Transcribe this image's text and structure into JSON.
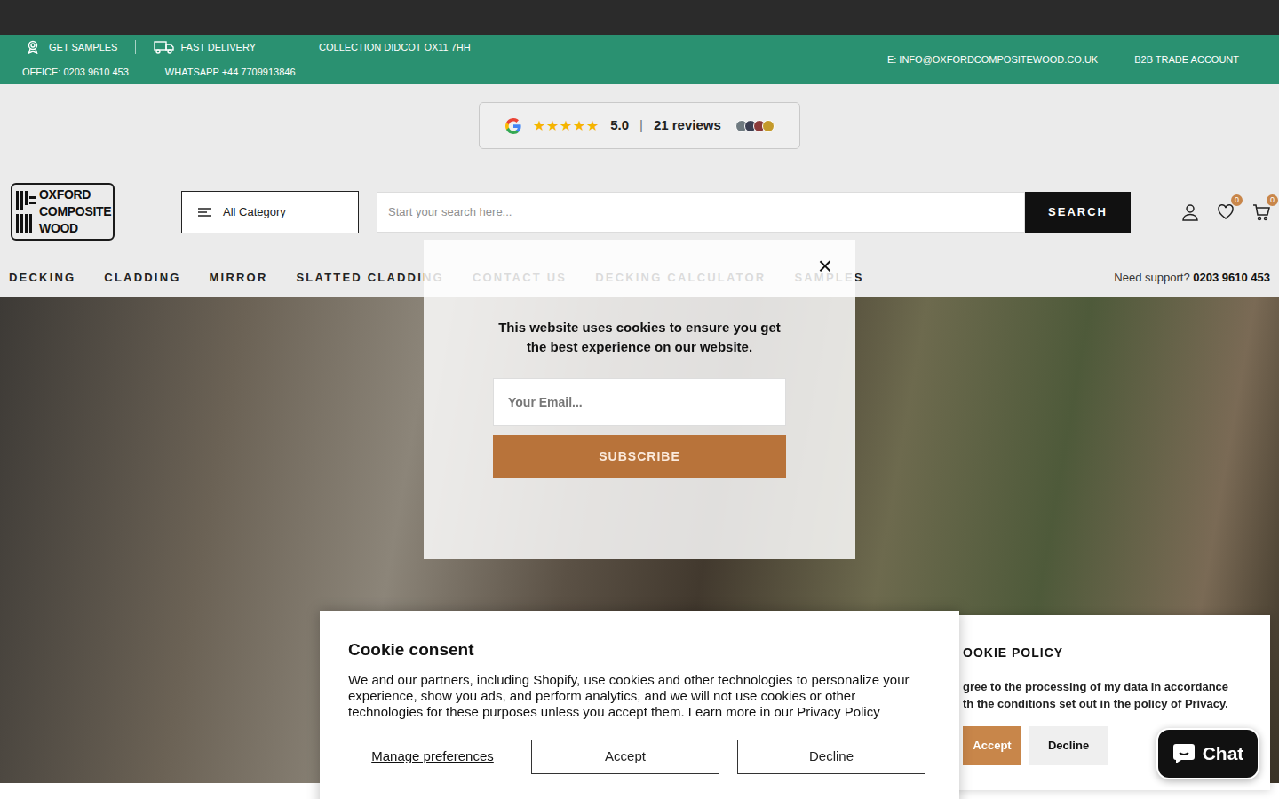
{
  "info_bar": {
    "row1": [
      "GET SAMPLES",
      "FAST DELIVERY",
      "COLLECTION DIDCOT OX11 7HH"
    ],
    "row2": [
      "OFFICE: 0203 9610 453",
      "WHATSAPP +44 7709913846"
    ],
    "right": [
      "E: INFO@OXFORDCOMPOSITEWOOD.CO.UK",
      "B2B TRADE ACCOUNT"
    ]
  },
  "reviews": {
    "stars": 5,
    "rating": "5.0",
    "separator": "|",
    "count": "21 reviews"
  },
  "logo": {
    "lines": [
      "OXFORD",
      "COMPOSITE",
      "WOOD"
    ]
  },
  "category": {
    "label": "All Category"
  },
  "search": {
    "placeholder": "Start your search here...",
    "button": "SEARCH"
  },
  "header_icons": {
    "wishlist_count": "0",
    "cart_count": "0"
  },
  "nav": {
    "items": [
      "DECKING",
      "CLADDING",
      "MIRROR",
      "SLATTED CLADDING",
      "CONTACT US",
      "DECKING CALCULATOR",
      "SAMPLES"
    ],
    "support_label": "Need support?",
    "support_phone": "0203 9610 453"
  },
  "popup": {
    "close": "×",
    "message": "This website uses cookies to ensure you get the best experience on our website.",
    "email_placeholder": "Your Email...",
    "button": "SUBSCRIBE"
  },
  "cookie_consent": {
    "title": "Cookie consent",
    "text": "We and our partners, including Shopify, use cookies and other technologies to personalize your experience, show you ads, and perform analytics, and we will not use cookies or other technologies for these purposes unless you accept them. Learn more in our ",
    "link": "Privacy Policy",
    "manage": "Manage preferences",
    "accept": "Accept",
    "decline": "Decline"
  },
  "cookie_policy": {
    "title": "OOKIE POLICY",
    "lines": [
      "gree to the processing of my data in accordance",
      "th the conditions set out in the policy of Privacy."
    ],
    "accept": "Accept",
    "decline": "Decline"
  },
  "chat": {
    "label": "Chat"
  }
}
